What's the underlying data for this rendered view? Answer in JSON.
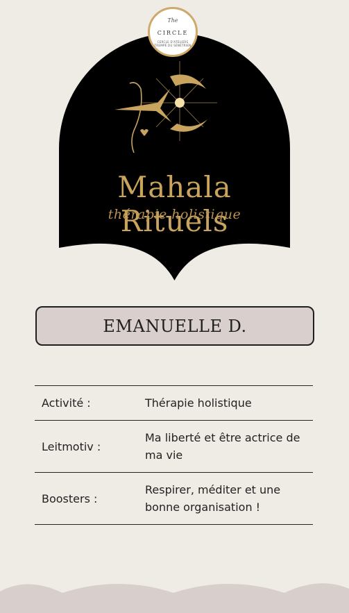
{
  "seal": {
    "the": "The",
    "word": "CIRCLE",
    "tagline": "CERCLE D'ATELIERS TREMPÉ DU SÉNÉTRIEN"
  },
  "brand": {
    "name": "Mahala Rituels",
    "tagline": "thérapie holistique"
  },
  "profile": {
    "name": "EMANUELLE D."
  },
  "info": [
    {
      "label": "Activité :",
      "value": "Thérapie holistique"
    },
    {
      "label": "Leitmotiv :",
      "value": "Ma liberté et être actrice de ma vie"
    },
    {
      "label": "Boosters :",
      "value": "Respirer, méditer et une bonne organisation !"
    }
  ],
  "colors": {
    "background": "#efebe5",
    "arch": "#000000",
    "gold": "#c9a45e",
    "name_box": "#d9cfcd",
    "waves": "#d8cfcd"
  }
}
